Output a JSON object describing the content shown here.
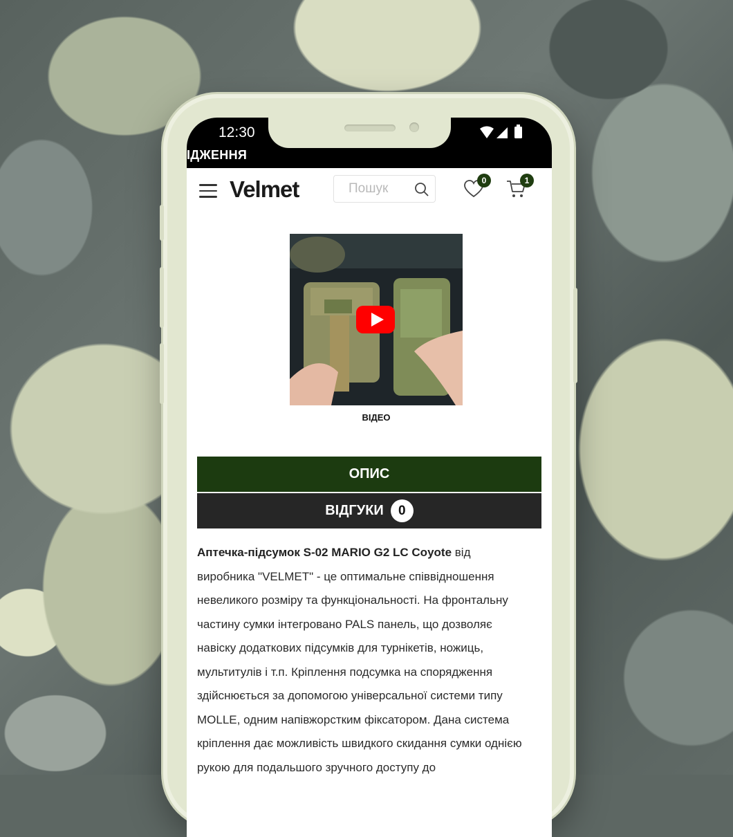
{
  "status_bar": {
    "time": "12:30"
  },
  "top_banner": {
    "text": "ІДЖЕННЯ"
  },
  "header": {
    "logo": "Velmet",
    "search_placeholder": "Пошук",
    "wishlist_count": "0",
    "cart_count": "1"
  },
  "media": {
    "video_label": "ВІДЕО"
  },
  "tabs": {
    "description": "ОПИС",
    "reviews": "ВІДГУКИ",
    "reviews_count": "0"
  },
  "description": {
    "product_name": "Аптечка-підсумок S-02 MARIO G2 LC Coyote",
    "text": " від виробника \"VELMET\" - це оптимальне співвідношення невеликого розміру та функціональності. На фронтальну частину сумки інтегровано PALS панель, що дозволяє навіску додаткових підсумків для турнікетів, ножиць, мультитулів і т.п. Кріплення подсумка на спорядження здійснюється за допомогою універсальної системи типу MOLLE, одним напівжорстким фіксатором. Дана система кріплення дає можливість швидкого скидання сумки однією рукою для подальшого зручного доступу до"
  },
  "colors": {
    "brand_green": "#1c3b10",
    "dark_tab": "#262626",
    "badge": "#1f3d10",
    "youtube_red": "#ff0000"
  }
}
